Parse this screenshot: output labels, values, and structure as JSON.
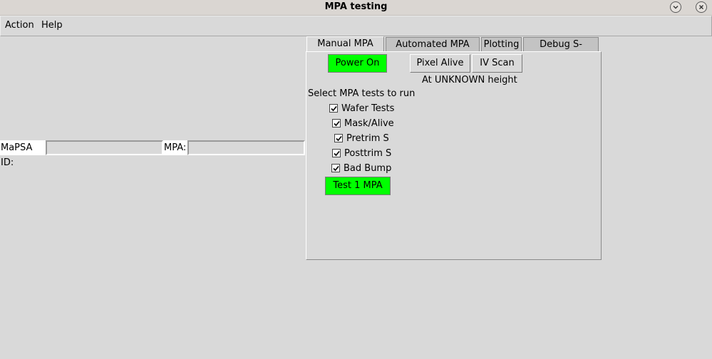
{
  "window": {
    "title": "MPA testing"
  },
  "menubar": {
    "items": [
      {
        "label": "Action"
      },
      {
        "label": "Help"
      }
    ]
  },
  "id_row": {
    "mapsa_label": "MaPSA ID:",
    "mapsa_value": "",
    "mpa_label": "MPA:",
    "mpa_value": ""
  },
  "tabs": [
    {
      "label": "Manual MPA test",
      "active": true
    },
    {
      "label": "Automated MPA test",
      "active": false
    },
    {
      "label": "Plotting",
      "active": false
    },
    {
      "label": "Debug S-Curves",
      "active": false
    }
  ],
  "manual_tab": {
    "power_button": "Power On",
    "pixel_alive_button": "Pixel Alive",
    "iv_scan_button": "IV Scan",
    "height_status": "At UNKNOWN height",
    "select_label": "Select MPA tests to run",
    "tests": [
      {
        "label": "Wafer Tests",
        "checked": true
      },
      {
        "label": "Mask/Alive",
        "checked": true
      },
      {
        "label": "Pretrim S",
        "checked": true
      },
      {
        "label": "Posttrim S",
        "checked": true
      },
      {
        "label": "Bad Bump",
        "checked": true
      }
    ],
    "run_button": "Test 1 MPA"
  },
  "colors": {
    "background": "#d9d9d9",
    "green_button": "#00ff00",
    "entry_label_bg": "#ffffff"
  },
  "icons": {
    "minimize": "chevron-down-icon",
    "close": "close-icon",
    "checkmark": "check-icon"
  }
}
